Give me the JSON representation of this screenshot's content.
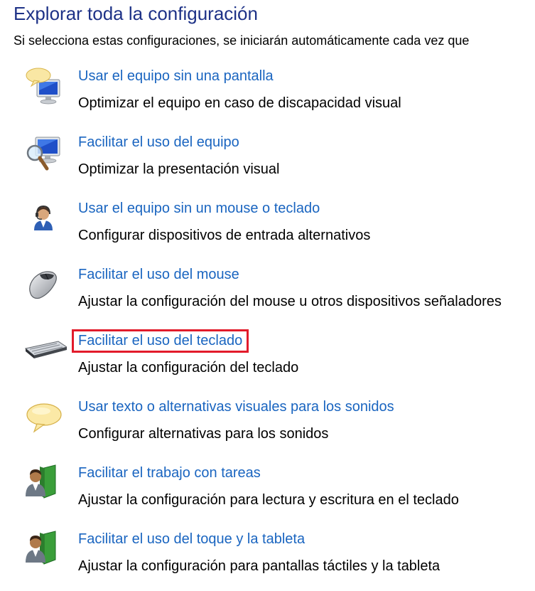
{
  "page": {
    "title": "Explorar toda la configuración",
    "intro": "Si selecciona estas configuraciones, se iniciarán automáticamente cada vez que"
  },
  "items": [
    {
      "icon": "monitor-speech-icon",
      "link": "Usar el equipo sin una pantalla",
      "description": "Optimizar el equipo en caso de discapacidad visual"
    },
    {
      "icon": "magnifier-monitor-icon",
      "link": "Facilitar el uso del equipo",
      "description": "Optimizar la presentación visual"
    },
    {
      "icon": "headset-user-icon",
      "link": "Usar el equipo sin un mouse o teclado",
      "description": "Configurar dispositivos de entrada alternativos"
    },
    {
      "icon": "mouse-icon",
      "link": "Facilitar el uso del mouse",
      "description": "Ajustar la configuración del mouse u otros dispositivos señaladores"
    },
    {
      "icon": "keyboard-icon",
      "link": "Facilitar el uso del teclado",
      "description": "Ajustar la configuración del teclado",
      "highlighted": true
    },
    {
      "icon": "speech-bubble-icon",
      "link": "Usar texto o alternativas visuales para los sonidos",
      "description": "Configurar alternativas para los sonidos"
    },
    {
      "icon": "user-book-icon",
      "link": "Facilitar el trabajo con tareas",
      "description": "Ajustar la configuración para lectura y escritura en el teclado"
    },
    {
      "icon": "user-book-icon",
      "link": "Facilitar el uso del toque y la tableta",
      "description": "Ajustar la configuración para pantallas táctiles y la tableta"
    }
  ],
  "colors": {
    "heading": "#1e3287",
    "link": "#1a65c0",
    "highlight": "#e21b2b"
  }
}
